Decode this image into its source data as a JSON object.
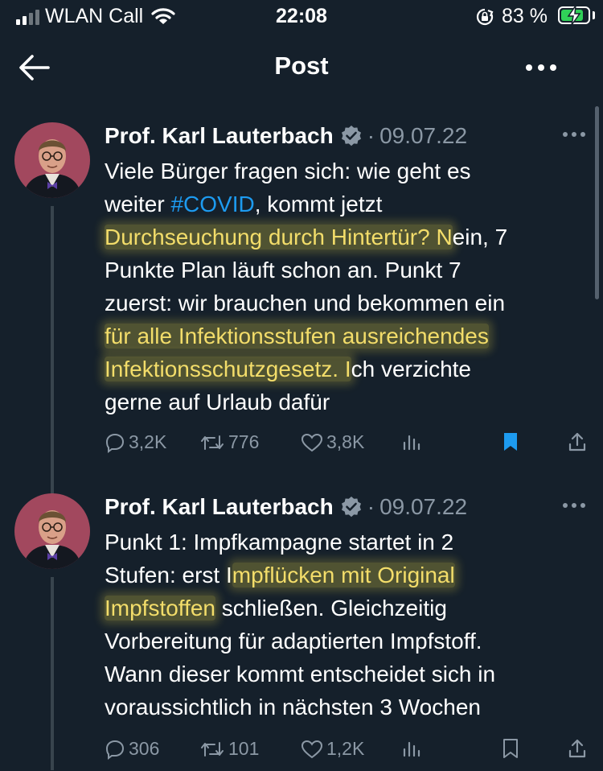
{
  "status_bar": {
    "carrier": "WLAN Call",
    "time": "22:08",
    "battery_percent": "83 %",
    "battery_level": 0.83,
    "icons": [
      "signal-icon",
      "wifi-icon",
      "rotation-lock-icon",
      "battery-charging-icon"
    ]
  },
  "header": {
    "title": "Post",
    "icons": [
      "back-arrow-icon",
      "more-options-icon"
    ]
  },
  "tweets": [
    {
      "author": "Prof. Karl Lauterbach",
      "separator": "·",
      "date": "09.07.22",
      "lines": [
        {
          "a": "Viele Bürger fragen sich: wie geht es"
        },
        {
          "a": "weiter ",
          "hashtag": "#COVID",
          "b": ", kommt jetzt"
        },
        {
          "hl": "Durchseuchung durch Hintertür? N",
          "b": "ein, 7"
        },
        {
          "a": "Punkte Plan läuft schon an. Punkt 7"
        },
        {
          "a": "zuerst: wir brauchen und bekommen ein"
        },
        {
          "hl": "für alle Infektionsstufen ausreichendes"
        },
        {
          "hl": "Infektionsschutzgesetz. I",
          "b": "ch verzichte"
        },
        {
          "a": "gerne auf Urlaub dafür"
        }
      ],
      "replies": "3,2K",
      "retweets": "776",
      "likes": "3,8K",
      "bookmarked": true
    },
    {
      "author": "Prof. Karl Lauterbach",
      "separator": "·",
      "date": "09.07.22",
      "lines": [
        {
          "a": "Punkt 1: Impfkampagne startet in 2"
        },
        {
          "a": "Stufen: erst I",
          "hl": "mpflücken mit Original"
        },
        {
          "hl": "Impfstoffen",
          "b": " schließen. Gleichzeitig"
        },
        {
          "a": "Vorbereitung für adaptierten Impfstoff."
        },
        {
          "a": "Wann dieser kommt entscheidet sich in"
        },
        {
          "a": "voraussichtlich in nächsten 3 Wochen"
        }
      ],
      "replies": "306",
      "retweets": "101",
      "likes": "1,2K",
      "bookmarked": false
    }
  ],
  "colors": {
    "background": "#15202b",
    "hashtag": "#1d9bf0",
    "highlight": "#f3dd6a",
    "muted": "#8b98a5",
    "bookmark_active": "#1d9bf0",
    "battery": "#30d158"
  }
}
